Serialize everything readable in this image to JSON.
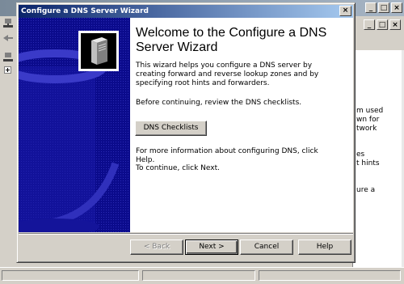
{
  "dialog": {
    "title": "Configure a DNS Server Wizard",
    "close_label": "×",
    "heading": "Welcome to the Configure a DNS Server Wizard",
    "intro": "This wizard helps you configure a DNS server by creating forward and reverse lookup zones and by specifying root hints and forwarders.",
    "review": "Before continuing, review the DNS checklists.",
    "checklists_button": "DNS Checklists",
    "more_info": "For more information about configuring DNS, click Help.",
    "continue": "To continue, click Next.",
    "buttons": {
      "back": "< Back",
      "next": "Next >",
      "cancel": "Cancel",
      "help": "Help"
    }
  },
  "background": {
    "window_controls": [
      "_",
      "□",
      "×"
    ],
    "child_controls": [
      "_",
      "□",
      "×"
    ],
    "right_pane_text": [
      "m used",
      "wn for",
      "twork",
      "es",
      "t hints",
      "ure a"
    ]
  },
  "colors": {
    "titlebar_start": "#0a246a",
    "titlebar_end": "#a6caf0",
    "watermark": "#0b0b8c",
    "dialog_face": "#d4d0c8"
  }
}
